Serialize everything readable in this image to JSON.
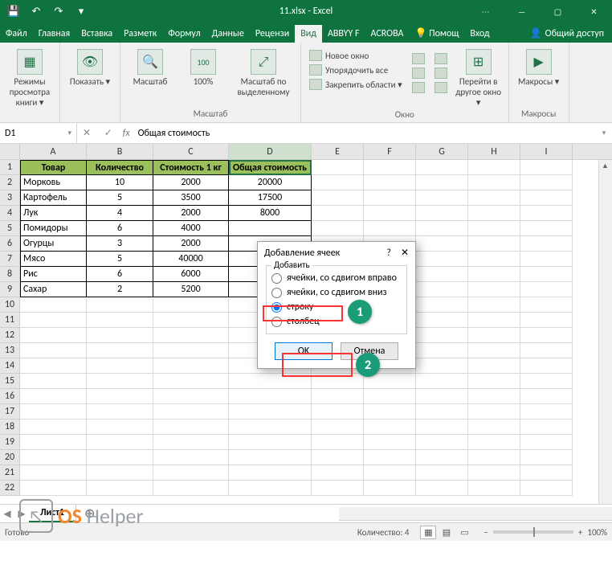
{
  "window": {
    "title": "11.xlsx - Excel"
  },
  "qat": {
    "save": "💾",
    "undo": "↶",
    "redo": "↷",
    "more": "▾"
  },
  "wincontrols": {
    "opts": "⋯",
    "min": "—",
    "max": "▢",
    "close": "✕"
  },
  "tabs": {
    "file": "Файл",
    "home": "Главная",
    "insert": "Вставка",
    "layout": "Разметк",
    "formulas": "Формул",
    "data": "Данные",
    "review": "Рецензи",
    "view": "Вид",
    "abbyy": "ABBYY F",
    "acrobat": "ACROBA",
    "tell": "Помощ",
    "signin": "Вход",
    "share": "Общий доступ"
  },
  "ribbon": {
    "workbook_views": {
      "btn": "Режимы просмотра книги ▾",
      "group": ""
    },
    "show": {
      "btn": "Показать ▾"
    },
    "zoom": {
      "zoom": "Масштаб",
      "hundred": "100%",
      "selection": "Масштаб по выделенному",
      "group": "Масштаб"
    },
    "window": {
      "new": "Новое окно",
      "arrange": "Упорядочить все",
      "freeze": "Закрепить области ▾",
      "switch": "Перейти в другое окно ▾",
      "group": "Окно"
    },
    "macros": {
      "btn": "Макросы ▾",
      "group": "Макросы"
    }
  },
  "namebox": {
    "value": "D1",
    "arrow": "▾"
  },
  "formula": {
    "cancel": "✕",
    "enter": "✓",
    "fx": "fx",
    "value": "Общая стоимость",
    "expand": "▾"
  },
  "columns": [
    "A",
    "B",
    "C",
    "D",
    "E",
    "F",
    "G",
    "H",
    "I"
  ],
  "rows": [
    "1",
    "2",
    "3",
    "4",
    "5",
    "6",
    "7",
    "8",
    "9",
    "10",
    "11",
    "12",
    "13",
    "14",
    "15",
    "16",
    "17",
    "18",
    "19",
    "20",
    "21",
    "22"
  ],
  "table": {
    "headers": {
      "a": "Товар",
      "b": "Количество",
      "c": "Стоимость 1 кг",
      "d": "Общая стоимость"
    },
    "data": [
      {
        "a": "Морковь",
        "b": "10",
        "c": "2000",
        "d": "20000"
      },
      {
        "a": "Картофель",
        "b": "5",
        "c": "3500",
        "d": "17500"
      },
      {
        "a": "Лук",
        "b": "4",
        "c": "2000",
        "d": "8000"
      },
      {
        "a": "Помидоры",
        "b": "6",
        "c": "4000",
        "d": ""
      },
      {
        "a": "Огурцы",
        "b": "3",
        "c": "2000",
        "d": ""
      },
      {
        "a": "Мясо",
        "b": "5",
        "c": "40000",
        "d": ""
      },
      {
        "a": "Рис",
        "b": "6",
        "c": "6000",
        "d": ""
      },
      {
        "a": "Сахар",
        "b": "2",
        "c": "5200",
        "d": ""
      }
    ]
  },
  "dialog": {
    "title": "Добавление ячеек",
    "help": "?",
    "close": "✕",
    "group": "Добавить",
    "opt_right": "ячейки, со сдвигом вправо",
    "opt_down": "ячейки, со сдвигом вниз",
    "opt_row": "строку",
    "opt_col": "столбец",
    "ok": "OK",
    "cancel": "Отмена"
  },
  "annotations": {
    "one": "1",
    "two": "2"
  },
  "sheets": {
    "name": "Лист1",
    "add": "⊕"
  },
  "status": {
    "ready": "Готово",
    "count": "Количество: 4",
    "zoom_minus": "−",
    "zoom_plus": "+",
    "zoom_pct": "100%"
  },
  "watermark": {
    "os": "OS",
    "helper": "Helper",
    "cursor": "↖"
  }
}
